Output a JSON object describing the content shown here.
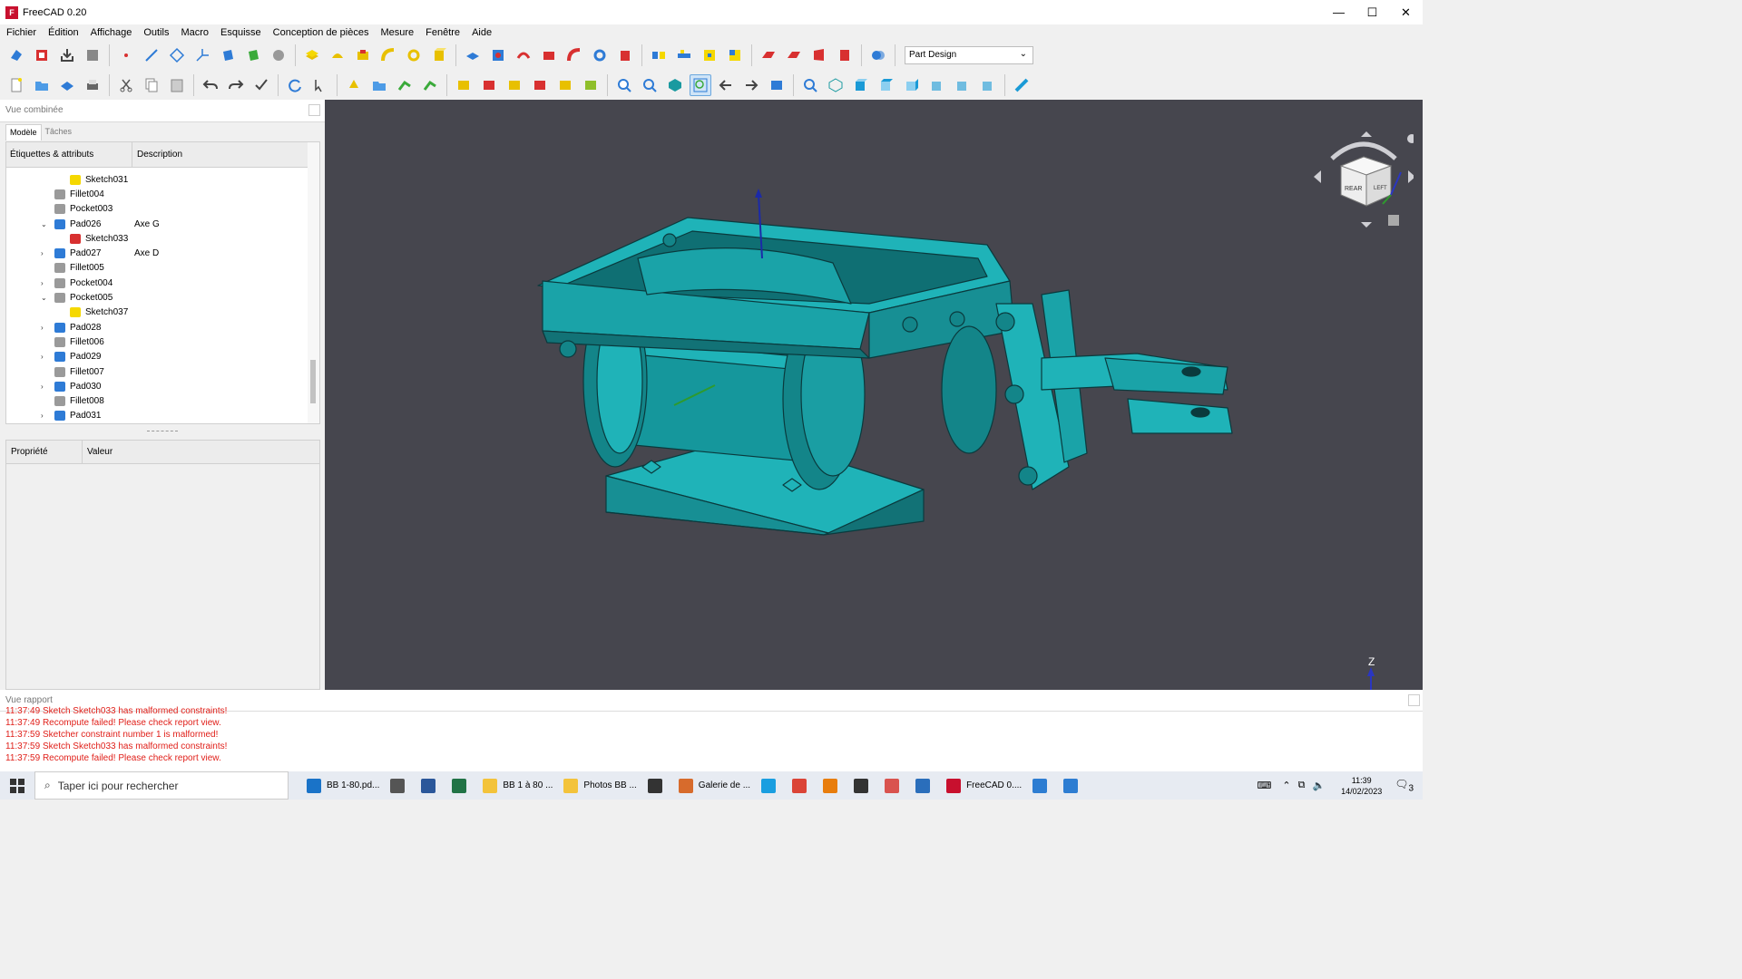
{
  "window": {
    "title": "FreeCAD 0.20",
    "minimize": "—",
    "maximize": "☐",
    "close": "✕"
  },
  "menu": [
    "Fichier",
    "Édition",
    "Affichage",
    "Outils",
    "Macro",
    "Esquisse",
    "Conception de pièces",
    "Mesure",
    "Fenêtre",
    "Aide"
  ],
  "workbench": {
    "selected": "Part Design"
  },
  "combo_view": {
    "title": "Vue combinée",
    "tabs": [
      "Modèle",
      "Tâches"
    ],
    "tree_headers": [
      "Étiquettes & attributs",
      "Description"
    ],
    "rows": [
      {
        "label": "Sketch031",
        "desc": "",
        "indent": 2,
        "icon": "sketch-icon",
        "arrow": ""
      },
      {
        "label": "Fillet004",
        "desc": "",
        "indent": 1,
        "icon": "fillet-icon",
        "arrow": ""
      },
      {
        "label": "Pocket003",
        "desc": "",
        "indent": 1,
        "icon": "pocket-icon",
        "arrow": ""
      },
      {
        "label": "Pad026",
        "desc": "Axe G",
        "indent": 1,
        "icon": "pad-icon",
        "arrow": "⌄"
      },
      {
        "label": "Sketch033",
        "desc": "",
        "indent": 2,
        "icon": "sketch-error-icon",
        "arrow": ""
      },
      {
        "label": "Pad027",
        "desc": "Axe D",
        "indent": 1,
        "icon": "pad-icon",
        "arrow": "›"
      },
      {
        "label": "Fillet005",
        "desc": "",
        "indent": 1,
        "icon": "fillet-icon",
        "arrow": ""
      },
      {
        "label": "Pocket004",
        "desc": "",
        "indent": 1,
        "icon": "pocket-icon",
        "arrow": "›"
      },
      {
        "label": "Pocket005",
        "desc": "",
        "indent": 1,
        "icon": "pocket-icon",
        "arrow": "⌄"
      },
      {
        "label": "Sketch037",
        "desc": "",
        "indent": 2,
        "icon": "sketch-icon",
        "arrow": ""
      },
      {
        "label": "Pad028",
        "desc": "",
        "indent": 1,
        "icon": "pad-icon",
        "arrow": "›"
      },
      {
        "label": "Fillet006",
        "desc": "",
        "indent": 1,
        "icon": "fillet-icon",
        "arrow": ""
      },
      {
        "label": "Pad029",
        "desc": "",
        "indent": 1,
        "icon": "pad-icon",
        "arrow": "›"
      },
      {
        "label": "Fillet007",
        "desc": "",
        "indent": 1,
        "icon": "fillet-icon",
        "arrow": ""
      },
      {
        "label": "Pad030",
        "desc": "",
        "indent": 1,
        "icon": "pad-icon",
        "arrow": "›"
      },
      {
        "label": "Fillet008",
        "desc": "",
        "indent": 1,
        "icon": "fillet-icon",
        "arrow": ""
      },
      {
        "label": "Pad031",
        "desc": "",
        "indent": 1,
        "icon": "pad-icon",
        "arrow": "›"
      }
    ],
    "props_headers": [
      "Propriété",
      "Valeur"
    ]
  },
  "viewport": {
    "navcube_top": "REAR",
    "navcube_right": "LEFT",
    "axis_z": "Z",
    "background": "#46464e",
    "model_color": "#1a9aa0"
  },
  "report": {
    "title": "Vue rapport",
    "lines": [
      "11:37:49  Sketch Sketch033 has malformed constraints!",
      "11:37:49  Recompute failed! Please check report view.",
      "11:37:59  Sketcher constraint number 1 is malformed!",
      "11:37:59  Sketch Sketch033 has malformed constraints!",
      "11:37:59  Recompute failed! Please check report view."
    ]
  },
  "taskbar": {
    "search_placeholder": "Taper ici pour rechercher",
    "items": [
      {
        "label": "BB 1-80.pd...",
        "color": "#1a73c8"
      },
      {
        "label": "",
        "color": "#555"
      },
      {
        "label": "",
        "color": "#2b579a"
      },
      {
        "label": "",
        "color": "#217346"
      },
      {
        "label": "BB 1 à 80 ...",
        "color": "#f3c33b"
      },
      {
        "label": "Photos BB ...",
        "color": "#f3c33b"
      },
      {
        "label": "",
        "color": "#333"
      },
      {
        "label": "Galerie de ...",
        "color": "#d76b2c"
      },
      {
        "label": "",
        "color": "#1a9ee0"
      },
      {
        "label": "",
        "color": "#db4437"
      },
      {
        "label": "",
        "color": "#e87d0d"
      },
      {
        "label": "",
        "color": "#333"
      },
      {
        "label": "",
        "color": "#d9534f"
      },
      {
        "label": "",
        "color": "#2a6ebb"
      },
      {
        "label": "FreeCAD 0....",
        "color": "#c8102e"
      },
      {
        "label": "",
        "color": "#2d7dd2"
      },
      {
        "label": "",
        "color": "#2d7dd2"
      }
    ],
    "time": "11:39",
    "date": "14/02/2023",
    "notif": "3"
  }
}
